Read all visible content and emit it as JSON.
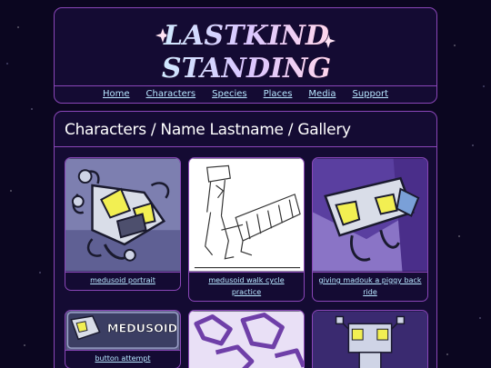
{
  "header": {
    "logo_alt": "Last Kind Standing logo",
    "logo_text_line1": "LASTKIND",
    "logo_text_line2": "STANDING"
  },
  "nav": [
    {
      "label": "Home"
    },
    {
      "label": "Characters"
    },
    {
      "label": "Species"
    },
    {
      "label": "Places"
    },
    {
      "label": "Media"
    },
    {
      "label": "Support"
    }
  ],
  "page": {
    "title": "Characters / Name Lastname / Gallery"
  },
  "gallery": [
    {
      "caption": "medusoid portrait"
    },
    {
      "caption": "medusoid walk cycle practice"
    },
    {
      "caption": "giving madouk a piggy back ride"
    },
    {
      "caption": "button attempt",
      "badge_text": "MEDUSOID"
    },
    {
      "caption": ""
    },
    {
      "caption": ""
    }
  ],
  "colors": {
    "background": "#0b0620",
    "panel": "#140b33",
    "border": "#8a46b8",
    "link": "#b7e6ff",
    "text": "#ffffff"
  }
}
